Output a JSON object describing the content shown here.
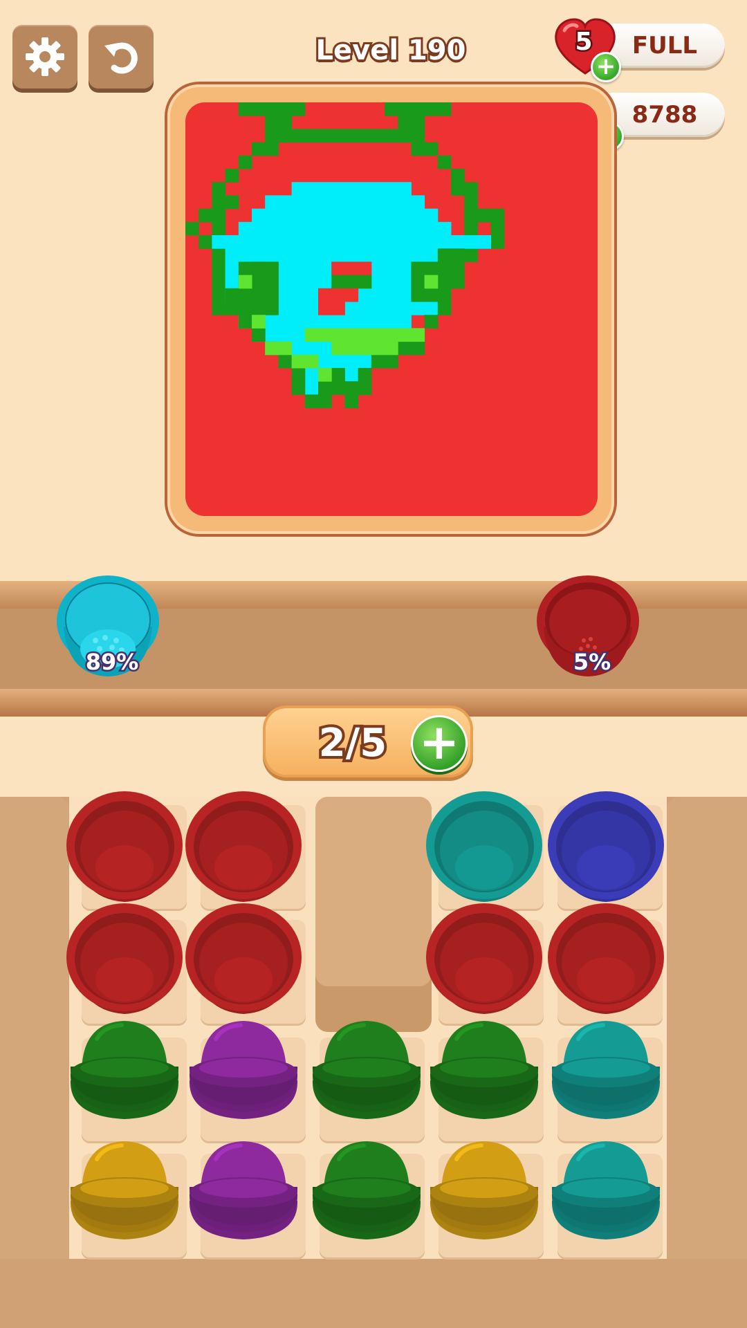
{
  "header": {
    "settings_icon": "gear-icon",
    "undo_icon": "undo-arrow-icon",
    "level_title": "Level 190",
    "lives_count": "5",
    "lives_status": "FULL",
    "coins": "8788"
  },
  "shelf": {
    "buckets": [
      {
        "color": "cyan",
        "hex": "#1ec5da",
        "fill_percent": 89,
        "label": "89%"
      },
      {
        "color": "red",
        "hex": "#b82424",
        "fill_percent": 5,
        "label": "5%"
      }
    ]
  },
  "counter": {
    "text": "2/5"
  },
  "board": {
    "rows": [
      [
        "red-bucket",
        "red-bucket",
        "empty",
        "teal-bucket",
        "blue-bucket"
      ],
      [
        "red-bucket",
        "red-bucket",
        "empty",
        "red-bucket",
        "red-bucket"
      ],
      [
        "green-stack",
        "purple-stack",
        "green-stack",
        "green-stack",
        "teal-stack"
      ],
      [
        "yellow-stack",
        "purple-stack",
        "green-stack",
        "yellow-stack",
        "teal-stack"
      ]
    ]
  },
  "colors": {
    "background": "#fce3c0",
    "canvas_red": "#ee3131",
    "picture_cyan": "#00eefa",
    "picture_green": "#1a9a1a",
    "picture_light_green": "#5fe52f",
    "red": "#b82424",
    "teal": "#149b93",
    "blue": "#3b3cb8",
    "green": "#1e7f1c",
    "purple": "#8d2a9e",
    "yellow": "#d29e13"
  }
}
